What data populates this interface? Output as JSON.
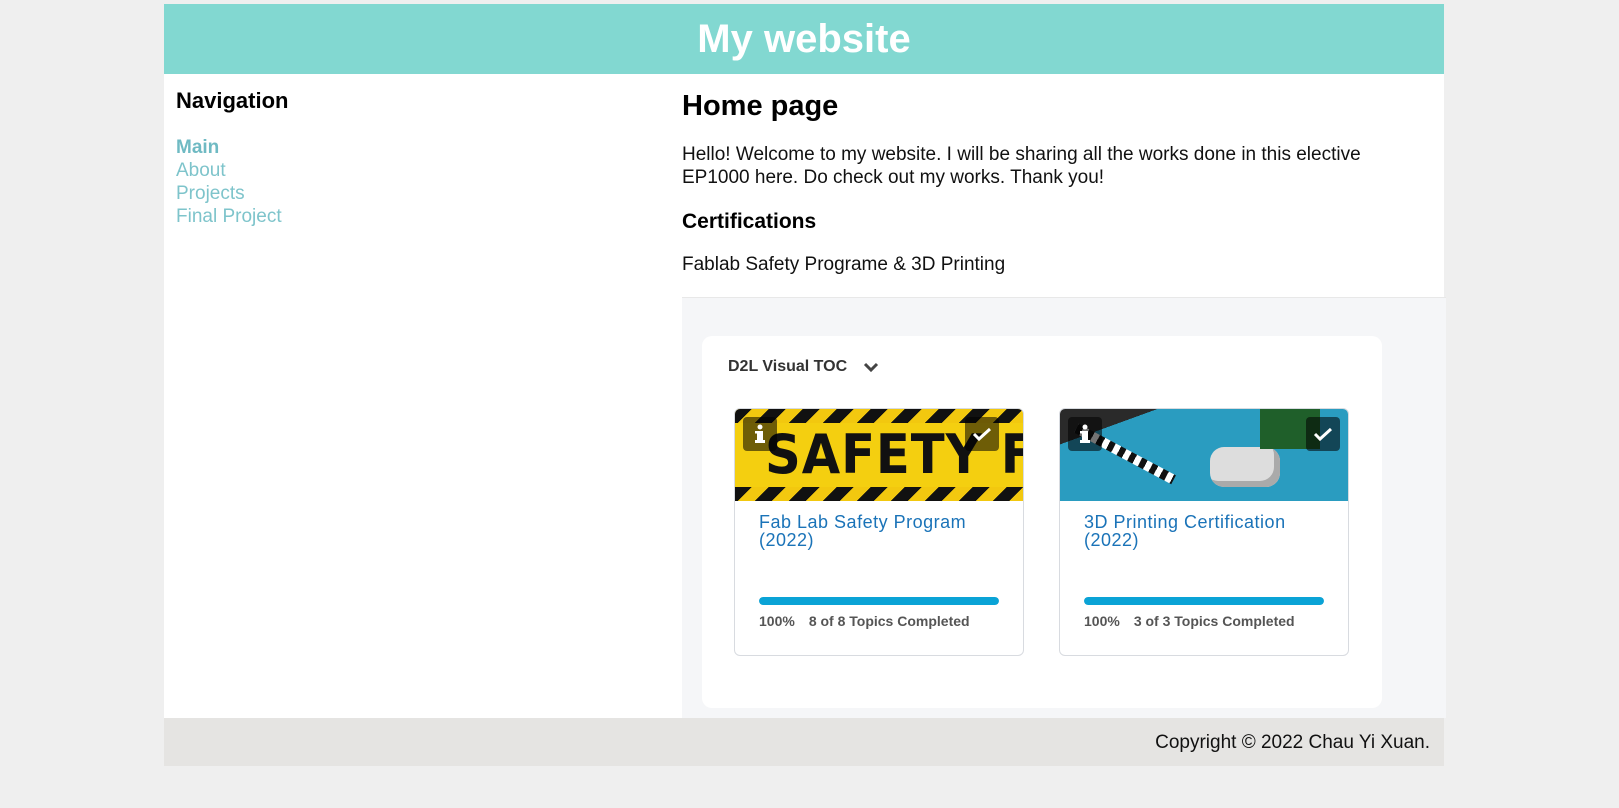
{
  "header": {
    "title": "My website"
  },
  "nav": {
    "title": "Navigation",
    "items": [
      {
        "label": "Main",
        "active": true
      },
      {
        "label": "About"
      },
      {
        "label": "Projects"
      },
      {
        "label": "Final Project"
      }
    ]
  },
  "main": {
    "heading": "Home page",
    "intro": "Hello! Welcome to my website. I will be sharing all the works done in this elective EP1000 here. Do check out my works. Thank you!",
    "cert_heading": "Certifications",
    "cert_text": "Fablab Safety Programe & 3D Printing"
  },
  "d2l": {
    "title": "D2L Visual TOC",
    "cards": [
      {
        "image_text": "SAFETY FI",
        "title": "Fab Lab Safety Program (2022)",
        "percent": "100%",
        "progress": 1.0,
        "status": "8 of 8 Topics Completed"
      },
      {
        "image_text": "",
        "title": "3D Printing Certification (2022)",
        "percent": "100%",
        "progress": 1.0,
        "status": "3 of 3 Topics Completed"
      }
    ]
  },
  "footer": {
    "copyright": "Copyright © 2022 Chau Yi Xuan."
  },
  "colors": {
    "header_bg": "#82d8d1",
    "nav_link": "#7ec4cb",
    "card_title": "#1a73b8",
    "progress": "#0aa3d6",
    "footer_bg": "#e5e4e2"
  }
}
